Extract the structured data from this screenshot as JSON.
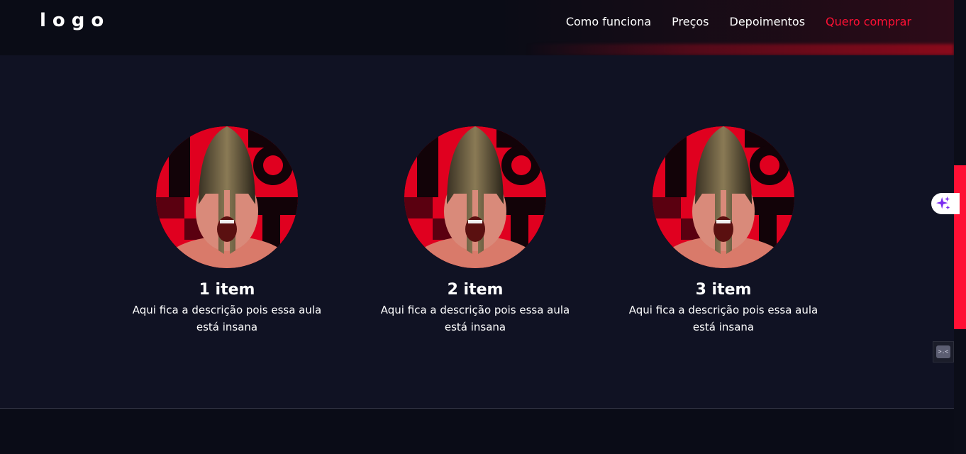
{
  "header": {
    "logo": "logo",
    "nav": [
      {
        "label": "Como funciona"
      },
      {
        "label": "Preços"
      },
      {
        "label": "Depoimentos"
      },
      {
        "label": "Quero comprar"
      }
    ]
  },
  "cards": [
    {
      "title": "1 item",
      "description": "Aqui fica a descrição pois essa aula está insana"
    },
    {
      "title": "2 item",
      "description": "Aqui fica a descrição pois essa aula está insana"
    },
    {
      "title": "3 item",
      "description": "Aqui fica a descrição pois essa aula está insana"
    }
  ],
  "widgets": {
    "ai_icon": "sparkle-icon",
    "dev_icon": "devtools-icon",
    "dev_label": ">.<"
  },
  "colors": {
    "background": "#101223",
    "header": "#0a0c16",
    "accent": "#ff1034",
    "text": "#ffffff",
    "sparkle": "#7a2cf0"
  }
}
